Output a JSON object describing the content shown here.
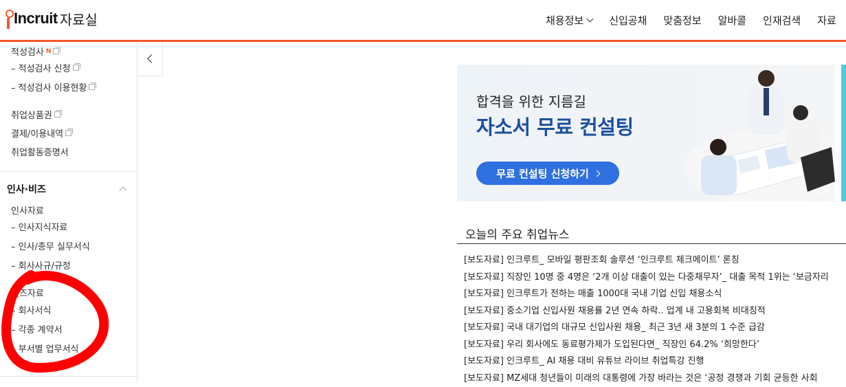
{
  "header": {
    "logo": "Incruit",
    "logo_sub": "자료실",
    "nav": [
      "채용정보",
      "신입공채",
      "맞춤정보",
      "알바콜",
      "인재검색",
      "자료"
    ]
  },
  "sidebar": {
    "test": {
      "label": "적성검사",
      "badge": "N"
    },
    "test_apply": "– 적성검사 신청",
    "test_status": "– 적성검사 이용현황",
    "voucher": "취업상품권",
    "payment": "결제/이용내역",
    "certificate": "취업활동증명서",
    "hr_section": "인사·비즈",
    "hr_docs": "인사자료",
    "hr_items": [
      "– 인사지식자료",
      "– 인사/총무 실무서식",
      "– 회사사규/규정"
    ],
    "biz_docs": "비즈자료",
    "biz_items": [
      "– 회사서식",
      "– 각종 계약서",
      "– 부서별 업무서식"
    ]
  },
  "banner": {
    "line1": "합격을 위한 지름길",
    "line2": "자소서 무료 컨설팅",
    "button": "무료 컨설팅 신청하기",
    "accent": "#2f6fe0",
    "headline_color": "#1c4f9e"
  },
  "news": {
    "title": "오늘의 주요 취업뉴스",
    "items": [
      "[보도자료] 인크루트_ 모바일 평판조회 솔루션 ‘인크루트 체크메이트’ 론칭",
      "[보도자료] 직장인 10명 중 4명은 ‘2개 이상 대출이 있는 다중채무자’_ 대출 목적 1위는 ‘보금자리",
      "[보도자료] 인크루트가 전하는 매출 1000대 국내 기업 신입 채용소식",
      "[보도자료] 중소기업 신입사원 채용률 2년 연속 하락.. 업계 내 고용회복 비대칭적",
      "[보도자료] 국내 대기업의 대규모 신입사원 채용_ 최근 3년 새 3분의 1 수준 급감",
      "[보도자료] 우리 회사에도 동료평가제가 도입된다면_ 직장인 64.2% ‘희망한다’",
      "[보도자료] 인크루트_ AI 채용 대비 유튜브 라이브 취업특강 진행",
      "[보도자료] MZ세대 청년들이 미래의 대통령에 가장 바라는 것은 ‘공정 경쟁과 기회 균등한 사회"
    ]
  },
  "colors": {
    "brand": "#f1592a",
    "annotation": "#ff0000"
  }
}
